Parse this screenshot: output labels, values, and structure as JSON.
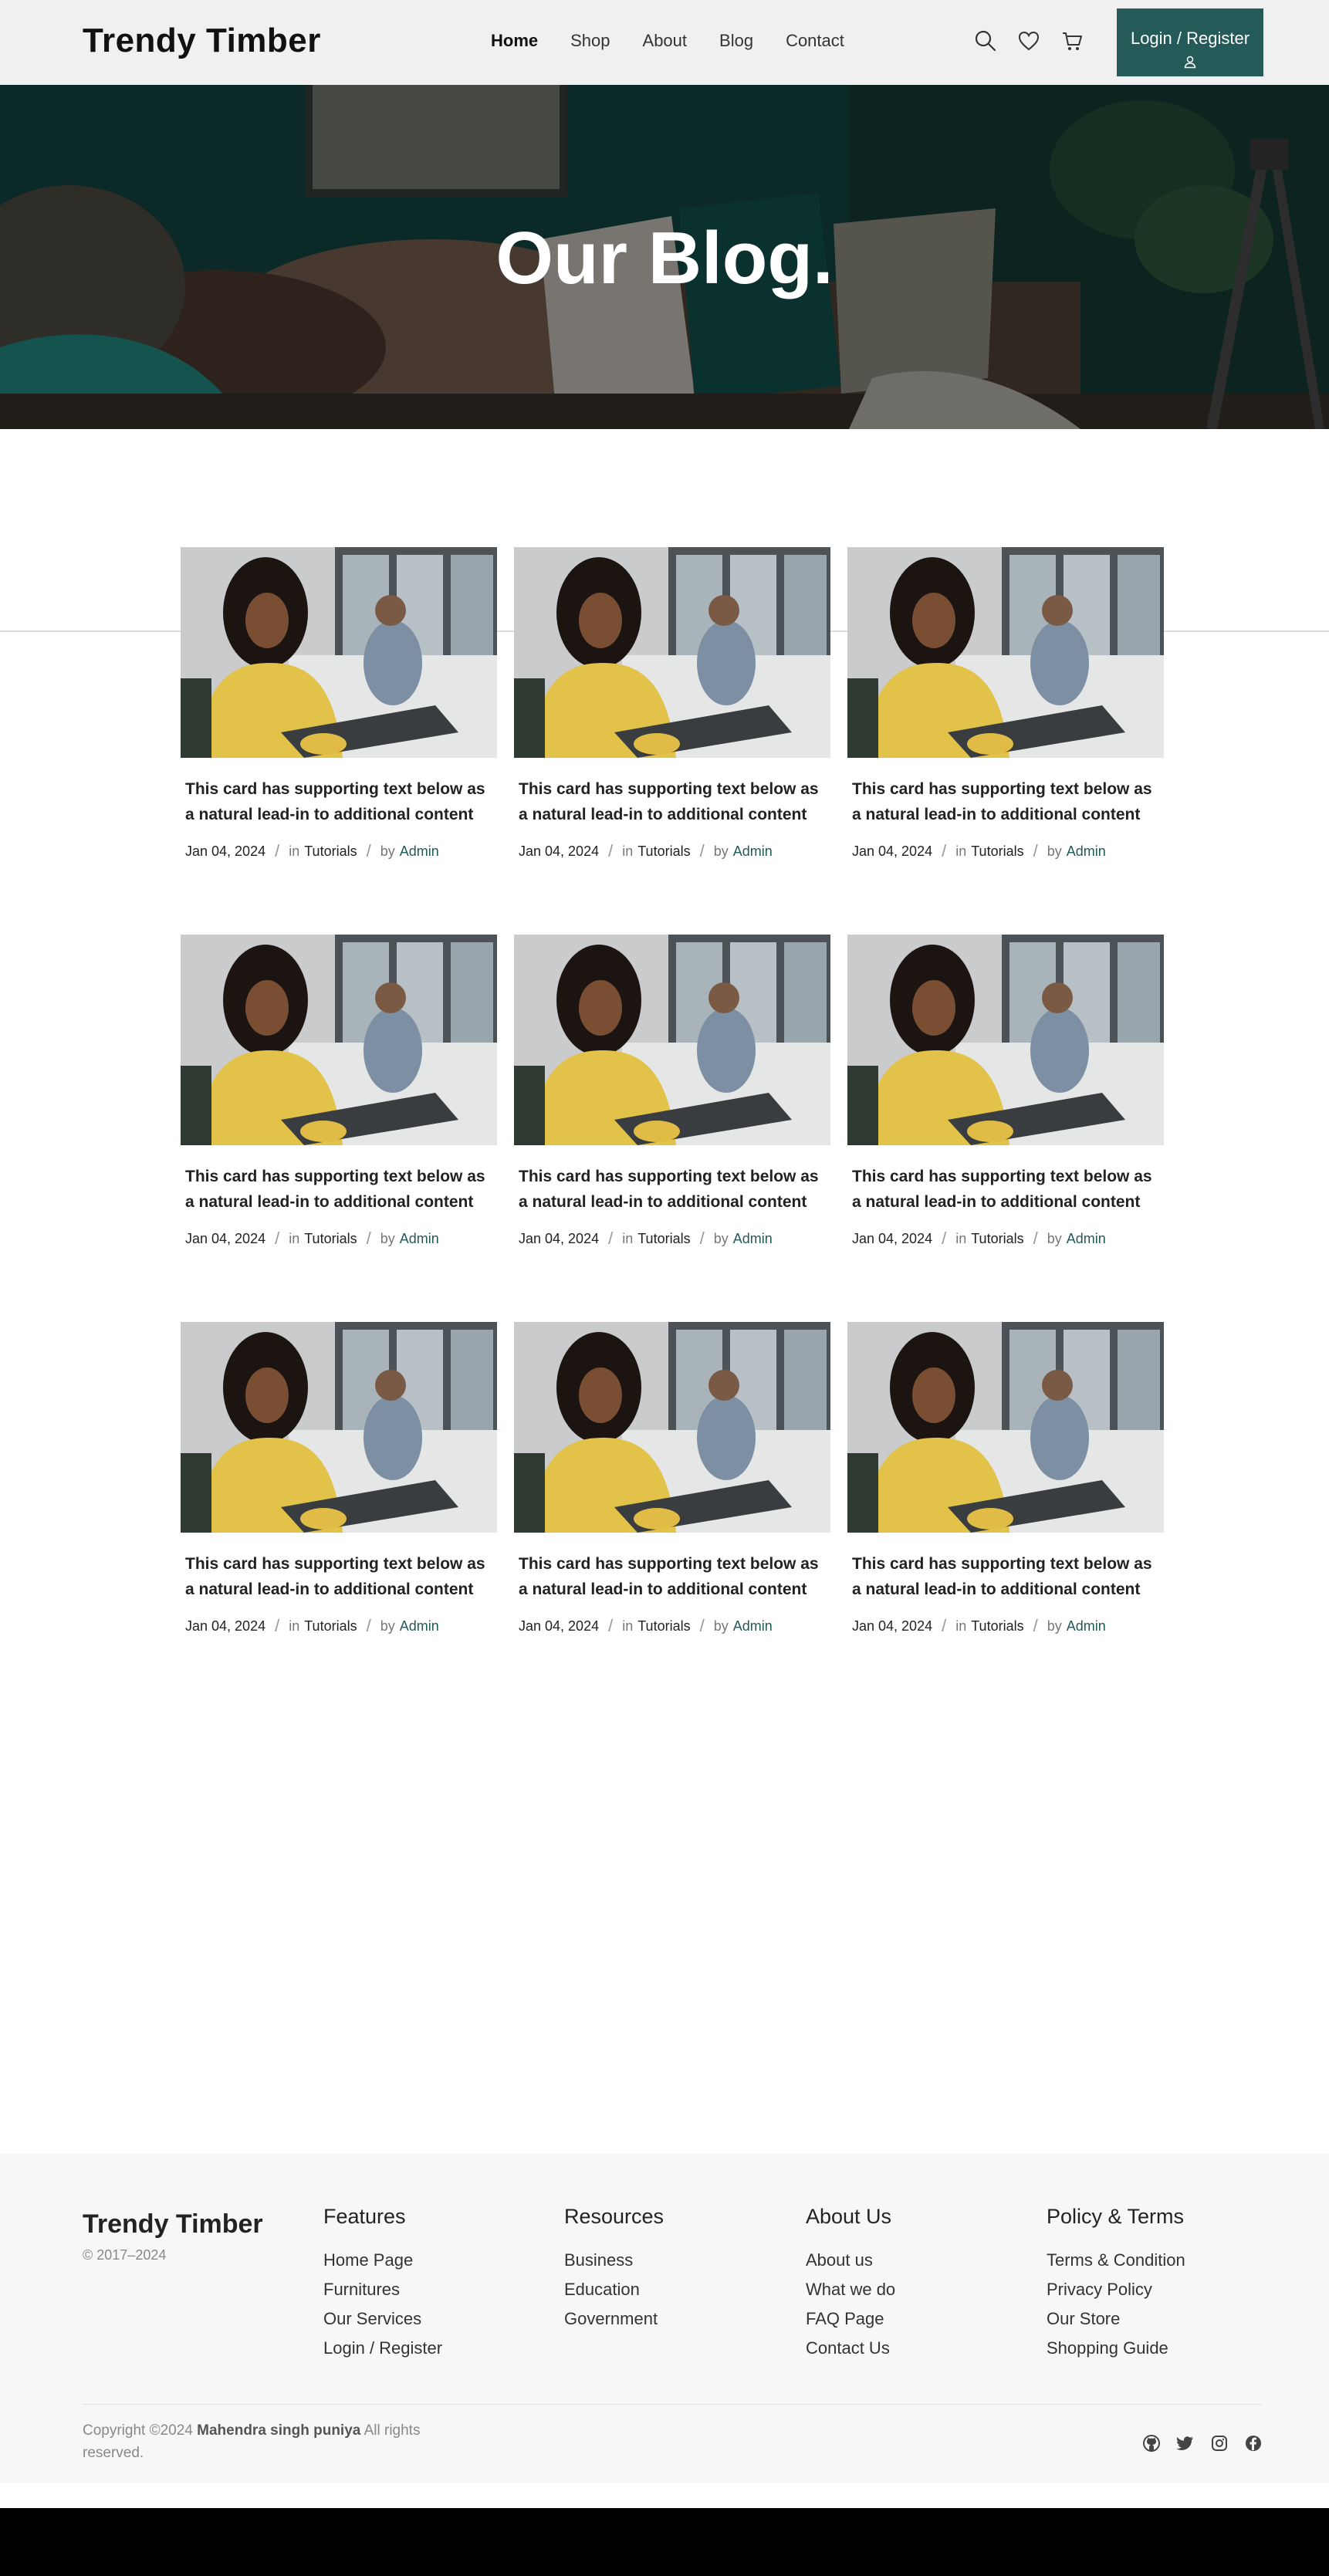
{
  "header": {
    "brand": "Trendy Timber",
    "nav": [
      "Home",
      "Shop",
      "About",
      "Blog",
      "Contact"
    ],
    "active_nav": "Home",
    "icons": [
      "search-icon",
      "heart-icon",
      "cart-icon"
    ],
    "login_label": "Login / Register",
    "login_icon": "user-icon",
    "accent_color": "#245a58"
  },
  "hero": {
    "title": "Our Blog."
  },
  "posts": [
    {
      "title": "This card has supporting text below as a natural lead-in to additional content",
      "date": "Jan 04, 2024",
      "in_label": "in",
      "category": "Tutorials",
      "by_label": "by",
      "author": "Admin"
    },
    {
      "title": "This card has supporting text below as a natural lead-in to additional content",
      "date": "Jan 04, 2024",
      "in_label": "in",
      "category": "Tutorials",
      "by_label": "by",
      "author": "Admin"
    },
    {
      "title": "This card has supporting text below as a natural lead-in to additional content",
      "date": "Jan 04, 2024",
      "in_label": "in",
      "category": "Tutorials",
      "by_label": "by",
      "author": "Admin"
    },
    {
      "title": "This card has supporting text below as a natural lead-in to additional content",
      "date": "Jan 04, 2024",
      "in_label": "in",
      "category": "Tutorials",
      "by_label": "by",
      "author": "Admin"
    },
    {
      "title": "This card has supporting text below as a natural lead-in to additional content",
      "date": "Jan 04, 2024",
      "in_label": "in",
      "category": "Tutorials",
      "by_label": "by",
      "author": "Admin"
    },
    {
      "title": "This card has supporting text below as a natural lead-in to additional content",
      "date": "Jan 04, 2024",
      "in_label": "in",
      "category": "Tutorials",
      "by_label": "by",
      "author": "Admin"
    },
    {
      "title": "This card has supporting text below as a natural lead-in to additional content",
      "date": "Jan 04, 2024",
      "in_label": "in",
      "category": "Tutorials",
      "by_label": "by",
      "author": "Admin"
    },
    {
      "title": "This card has supporting text below as a natural lead-in to additional content",
      "date": "Jan 04, 2024",
      "in_label": "in",
      "category": "Tutorials",
      "by_label": "by",
      "author": "Admin"
    },
    {
      "title": "This card has supporting text below as a natural lead-in to additional content",
      "date": "Jan 04, 2024",
      "in_label": "in",
      "category": "Tutorials",
      "by_label": "by",
      "author": "Admin"
    }
  ],
  "footer": {
    "brand": "Trendy Timber",
    "years": "© 2017–2024",
    "columns": [
      {
        "heading": "Features",
        "links": [
          "Home Page",
          "Furnitures",
          "Our Services",
          "Login / Register"
        ]
      },
      {
        "heading": "Resources",
        "links": [
          "Business",
          "Education",
          "Government"
        ]
      },
      {
        "heading": "About Us",
        "links": [
          "About us",
          "What we do",
          "FAQ Page",
          "Contact Us"
        ]
      },
      {
        "heading": "Policy & Terms",
        "links": [
          "Terms & Condition",
          "Privacy Policy",
          "Our Store",
          "Shopping Guide"
        ]
      }
    ],
    "copyright_prefix": "Copyright ©2024",
    "copyright_name": "Mahendra singh puniya",
    "copyright_suffix": "All rights reserved.",
    "social_icons": [
      "github-icon",
      "twitter-icon",
      "instagram-icon",
      "facebook-icon"
    ]
  }
}
